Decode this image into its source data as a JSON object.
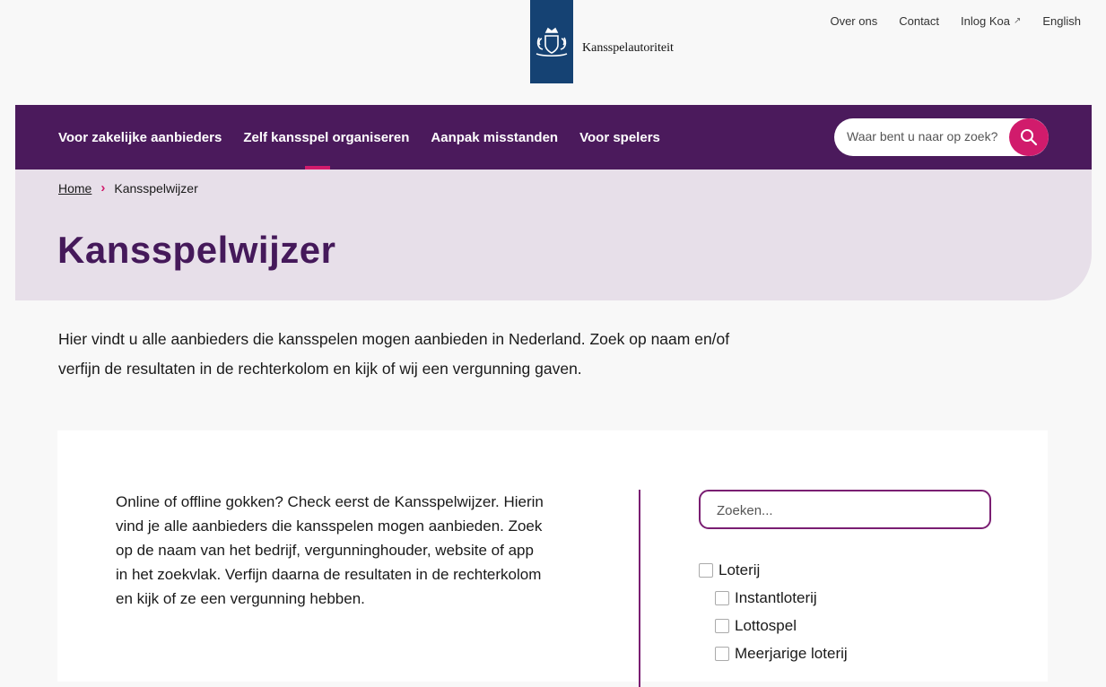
{
  "topnav": {
    "items": [
      "Over ons",
      "Contact",
      "Inlog Koa",
      "English"
    ]
  },
  "logo": {
    "name": "Kansspelautoriteit"
  },
  "mainnav": {
    "items": [
      "Voor zakelijke aanbieders",
      "Zelf kansspel organiseren",
      "Aanpak misstanden",
      "Voor spelers"
    ],
    "search_placeholder": "Waar bent u naar op zoek?"
  },
  "breadcrumb": {
    "home": "Home",
    "current": "Kansspelwijzer"
  },
  "page": {
    "title": "Kansspelwijzer",
    "intro": "Hier vindt u alle aanbieders die kansspelen mogen aanbieden in Nederland. Zoek op naam en/of verfijn de resultaten in de rechterkolom en kijk of wij een vergunning gaven."
  },
  "card": {
    "text": "Online of offline gokken? Check eerst de Kansspelwijzer. Hierin vind je alle aanbieders die kansspelen mogen aanbieden. Zoek op de naam van het bedrijf, vergunninghouder, website of app in het zoekvlak. Verfijn daarna de resultaten in de rechterkolom en kijk of ze een vergunning hebben.",
    "search_placeholder": "Zoeken...",
    "filters": {
      "parent": "Loterij",
      "children": [
        "Instantloterij",
        "Lottospel",
        "Meerjarige loterij"
      ]
    }
  },
  "colors": {
    "nav_bg": "#4b1a5c",
    "accent": "#d11b6c",
    "hero_bg": "#e7dfe9",
    "title": "#45195a",
    "logo_blue": "#154273"
  }
}
